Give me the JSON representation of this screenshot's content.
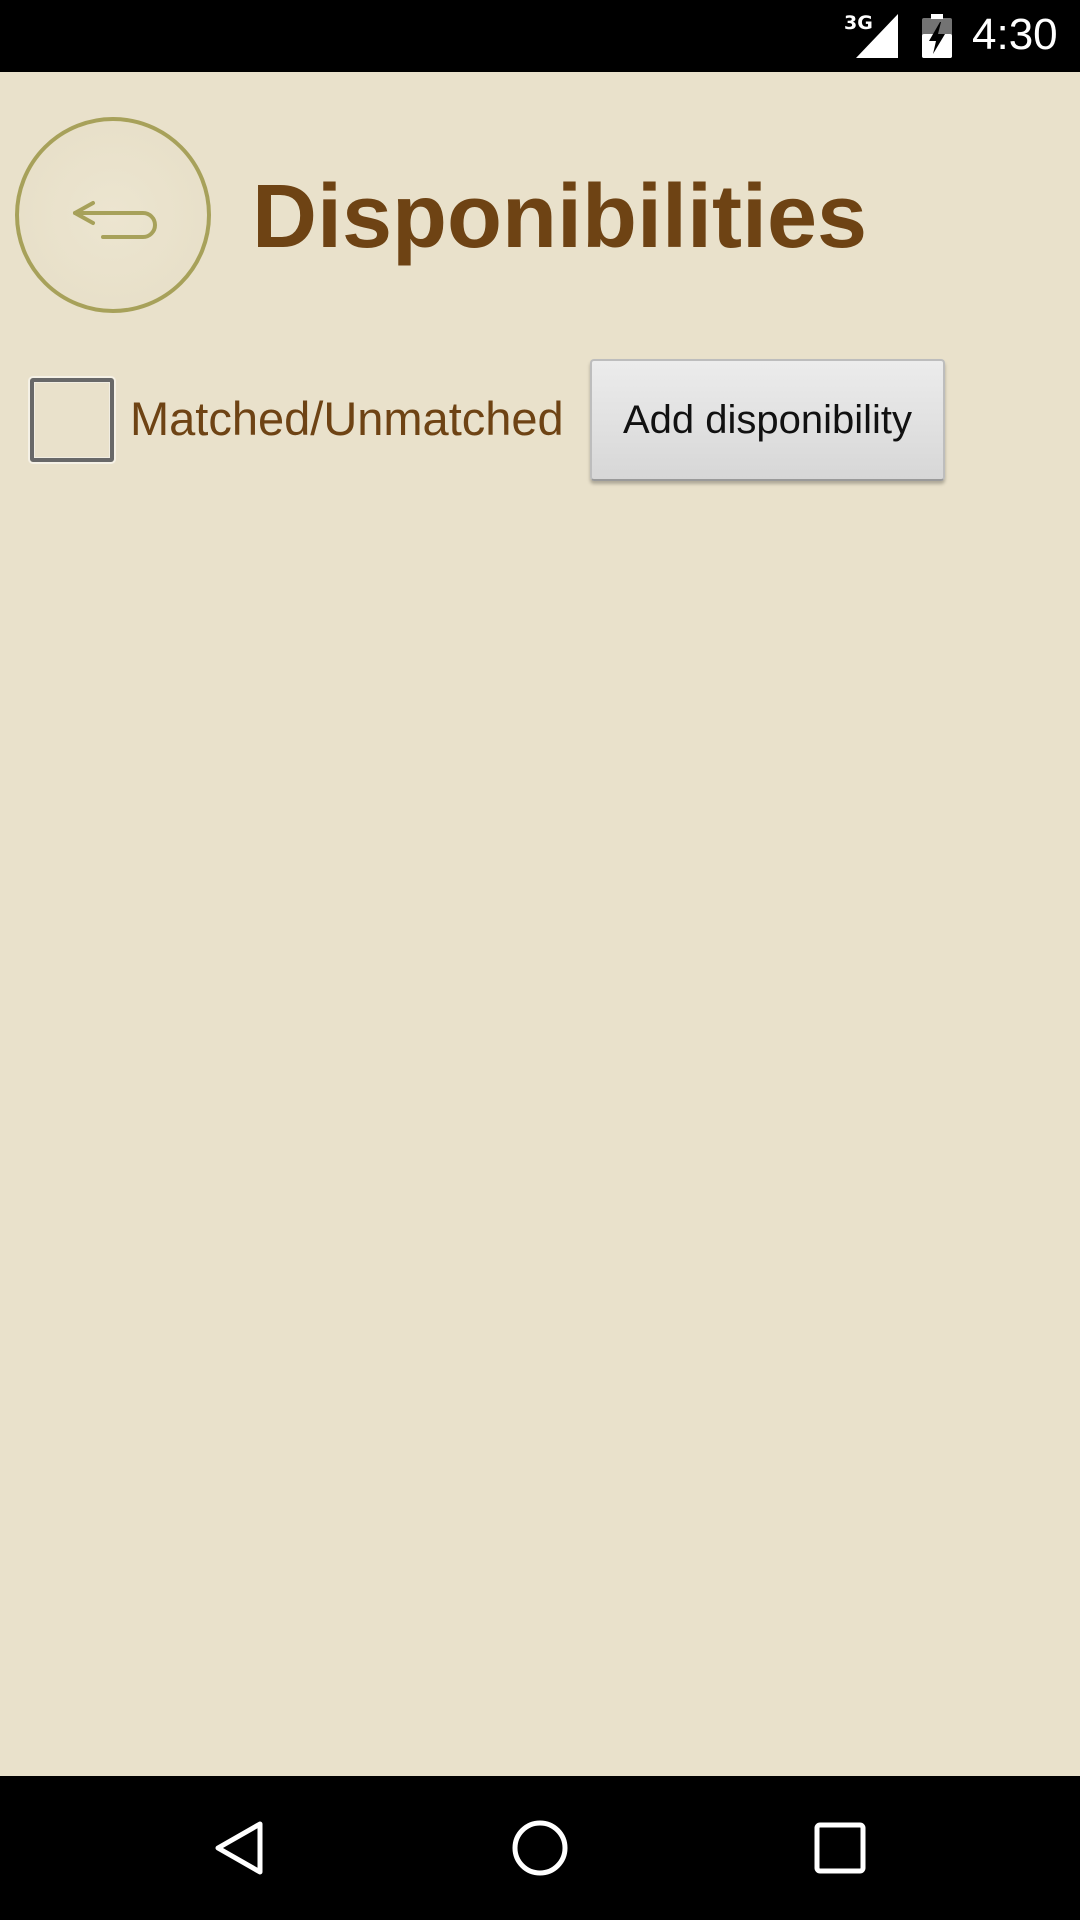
{
  "status_bar": {
    "network_type": "3G",
    "time": "4:30",
    "icons": [
      "signal-icon",
      "battery-charging-icon"
    ]
  },
  "header": {
    "back_icon": "return-arrow-icon",
    "title": "Disponibilities"
  },
  "filter": {
    "checkbox_label": "Matched/Unmatched",
    "checked": false
  },
  "actions": {
    "add_label": "Add disponibility"
  },
  "nav_bar": {
    "icons": [
      "nav-back-icon",
      "nav-home-icon",
      "nav-recents-icon"
    ]
  },
  "colors": {
    "background": "#e9e1cb",
    "title_text": "#6e4314",
    "back_ring": "#a7a15a",
    "system_bars": "#000000"
  }
}
